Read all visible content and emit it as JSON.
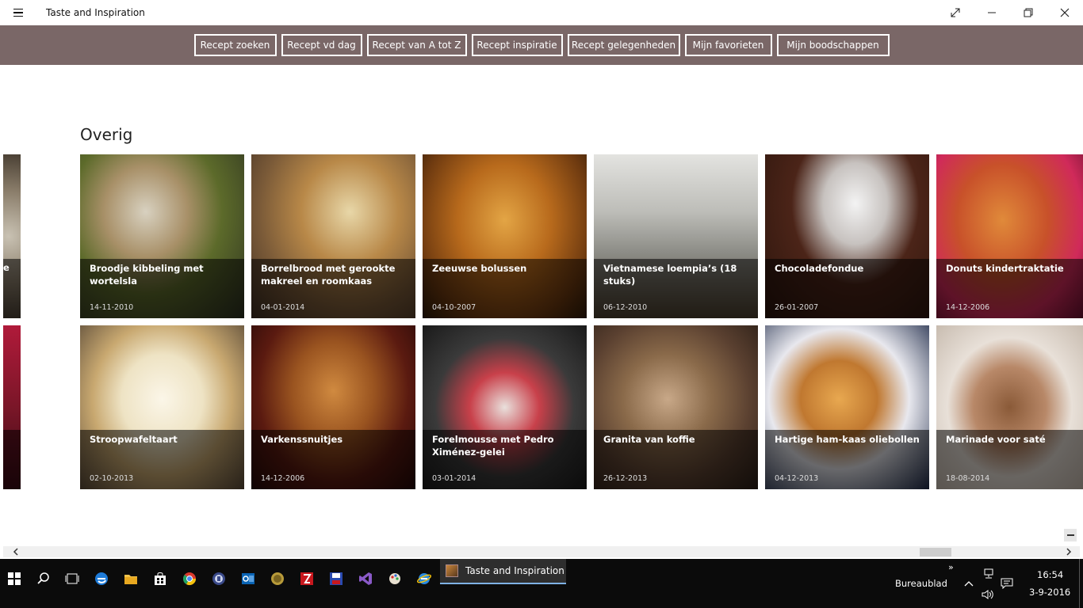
{
  "window": {
    "title": "Taste and Inspiration"
  },
  "nav": {
    "buttons": [
      {
        "label": "Recept zoeken"
      },
      {
        "label": "Recept vd dag"
      },
      {
        "label": "Recept van A tot Z"
      },
      {
        "label": "Recept inspiratie"
      },
      {
        "label": "Recept gelegenheden"
      },
      {
        "label": "Mijn favorieten"
      },
      {
        "label": "Mijn boodschappen"
      }
    ]
  },
  "section": {
    "title": "Overig"
  },
  "partial_tiles": {
    "top_fragment": "e"
  },
  "tiles": [
    {
      "name": "Broodje kibbeling met wortelsla",
      "date": "14-11-2010"
    },
    {
      "name": "Borrelbrood met gerookte makreel en roomkaas",
      "date": "04-01-2014"
    },
    {
      "name": "Zeeuwse bolussen",
      "date": "04-10-2007"
    },
    {
      "name": "Vietnamese loempia’s  (18 stuks)",
      "date": "06-12-2010"
    },
    {
      "name": "Chocoladefondue",
      "date": "26-01-2007"
    },
    {
      "name": "Donuts kindertraktatie",
      "date": "14-12-2006"
    },
    {
      "name": "Stroopwafeltaart",
      "date": "02-10-2013"
    },
    {
      "name": "Varkenssnuitjes",
      "date": "14-12-2006"
    },
    {
      "name": "Forelmousse met Pedro Ximénez-gelei",
      "date": "03-01-2014"
    },
    {
      "name": "Granita van koffie",
      "date": "26-12-2013"
    },
    {
      "name": "Hartige ham-kaas oliebollen",
      "date": "04-12-2013"
    },
    {
      "name": "Marinade voor saté",
      "date": "18-08-2014"
    }
  ],
  "taskbar": {
    "running_app": "Taste and Inspiration",
    "desktop_label": "Bureaublad",
    "overflow_glyph": "»",
    "time": "16:54",
    "date": "3-9-2016"
  }
}
